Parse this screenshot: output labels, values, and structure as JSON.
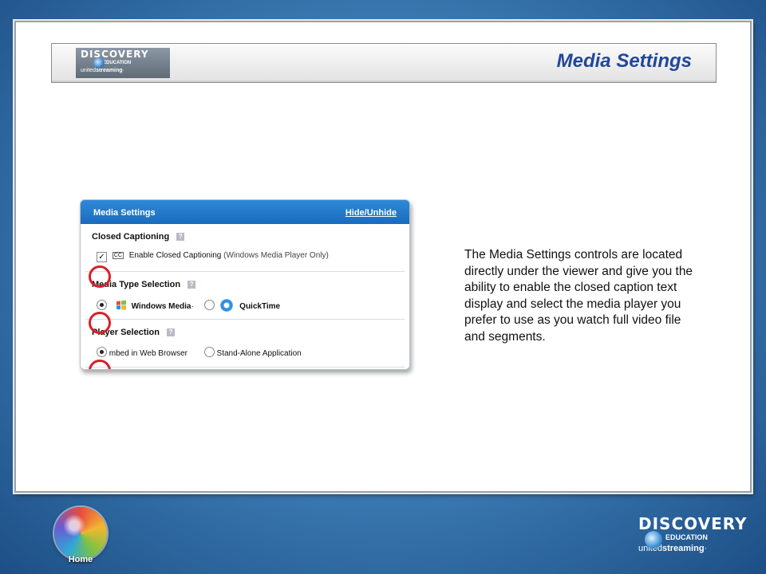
{
  "header": {
    "title": "Media Settings",
    "logo": {
      "line1": "DISCOVERY",
      "line2": "EDUCATION",
      "line3_light": "united",
      "line3_bold": "streaming",
      "line3_mark": "·"
    }
  },
  "panel": {
    "title": "Media Settings",
    "hide_link": "Hide/Unhide",
    "help_glyph": "?",
    "closed_captioning": {
      "heading": "Closed Captioning",
      "checkmark": "✓",
      "cc_glyph": "CC",
      "label": "Enable Closed Captioning",
      "note": "(Windows Media Player Only)",
      "checked": true
    },
    "media_type": {
      "heading": "Media Type Selection",
      "option1": "Windows Media",
      "option1_mark": "·",
      "option2": "QuickTime",
      "selected": "Windows Media"
    },
    "player": {
      "heading": "Player Selection",
      "option1": "mbed in Web Browser",
      "option2": "Stand-Alone Application",
      "selected": "mbed in Web Browser"
    }
  },
  "description": "The Media Settings controls are located directly under the viewer and give you the ability to enable the closed caption text display and select the media player you prefer to use as you watch full video file and segments.",
  "footer": {
    "home_label": "Home",
    "brand": {
      "line1": "DISCOVERY",
      "line2": "EDUCATION",
      "line3_light": "united",
      "line3_bold": "streaming",
      "line3_mark": "·"
    }
  },
  "colors": {
    "title_blue": "#22479a",
    "panel_header_blue": "#1a6bbd",
    "highlight_red": "#d8202a"
  },
  "icons": [
    "discovery-globe-icon",
    "help-icon",
    "closed-caption-icon",
    "windows-logo-icon",
    "quicktime-icon",
    "home-globe-icon"
  ]
}
